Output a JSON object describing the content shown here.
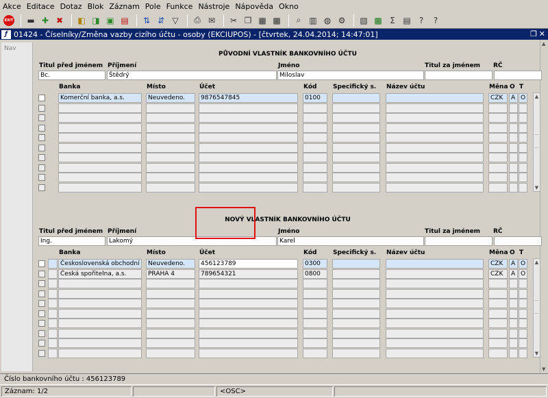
{
  "menu": [
    "Akce",
    "Editace",
    "Dotaz",
    "Blok",
    "Záznam",
    "Pole",
    "Funkce",
    "Nástroje",
    "Nápověda",
    "Okno"
  ],
  "toolbar": {
    "exit_label": "EXIT",
    "icons": [
      "save-icon",
      "new-record-icon",
      "delete-record-icon",
      "first-icon",
      "prev-icon",
      "next-icon",
      "last-icon",
      "sort-asc-icon",
      "sort-desc-icon",
      "filter-icon",
      "print-icon",
      "mail-icon",
      "cut-icon",
      "copy-icon",
      "paste-icon",
      "clear-icon",
      "find-icon",
      "query-icon",
      "globe-icon",
      "settings-icon",
      "calc-icon",
      "excel-icon",
      "sum-icon",
      "stats-icon",
      "help-icon",
      "question-icon"
    ]
  },
  "window": {
    "title": "01424 - Číselníky/Změna vazby cizího účtu - osoby (EKCIUPOS) - [čtvrtek, 24.04.2014; 14:47:01]",
    "nav_label": "Nav"
  },
  "original_owner": {
    "section_title": "PŮVODNÍ VLASTNÍK BANKOVNÍHO ÚČTU",
    "labels": {
      "titul_pred": "Titul před jménem",
      "prijmeni": "Příjmení",
      "jmeno": "Jméno",
      "titul_za": "Titul za jménem",
      "rc": "RČ"
    },
    "values": {
      "titul_pred": "Bc.",
      "prijmeni": "Štědrý",
      "jmeno": "Miloslav",
      "titul_za": "",
      "rc": ""
    },
    "table_headers": {
      "banka": "Banka",
      "misto": "Místo",
      "ucet": "Účet",
      "kod": "Kód",
      "specificky": "Specifický s.",
      "nazev": "Název účtu",
      "mena": "Měna",
      "o": "O",
      "t": "T"
    },
    "rows": [
      {
        "banka": "Komerční banka, a.s.",
        "misto": "Neuvedeno.",
        "ucet": "9876547845",
        "kod": "0100",
        "specificky": "",
        "nazev": "",
        "mena": "CZK",
        "o": "A",
        "t": "O"
      }
    ]
  },
  "new_owner": {
    "section_title": "NOVÝ VLASTNÍK BANKOVNÍHO ÚČTU",
    "labels": {
      "titul_pred": "Titul před jménem",
      "prijmeni": "Příjmení",
      "jmeno": "Jméno",
      "titul_za": "Titul za jménem",
      "rc": "RČ"
    },
    "values": {
      "titul_pred": "Ing.",
      "prijmeni": "Lakomý",
      "jmeno": "Karel",
      "titul_za": "",
      "rc": ""
    },
    "table_headers": {
      "banka": "Banka",
      "misto": "Místo",
      "ucet": "Účet",
      "kod": "Kód",
      "specificky": "Specifický s.",
      "nazev": "Název účtu",
      "mena": "Měna",
      "o": "O",
      "t": "T"
    },
    "rows": [
      {
        "banka": "Československá obchodní banka",
        "misto": "Neuvedeno.",
        "ucet": "456123789",
        "kod": "0300",
        "specificky": "",
        "nazev": "",
        "mena": "CZK",
        "o": "A",
        "t": "O"
      },
      {
        "banka": "Česká spořitelna, a.s.",
        "misto": "PRAHA 4",
        "ucet": "789654321",
        "kod": "0800",
        "specificky": "",
        "nazev": "",
        "mena": "CZK",
        "o": "A",
        "t": "O"
      }
    ]
  },
  "status": {
    "message": "Číslo bankovního účtu : 456123789",
    "record": "Záznam: 1/2",
    "mode": "<OSC>"
  }
}
